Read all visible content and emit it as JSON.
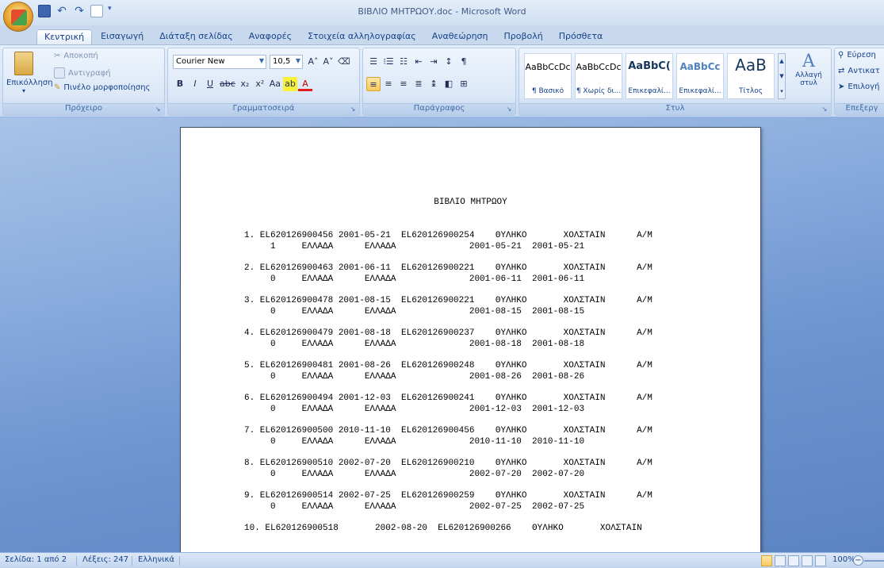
{
  "window": {
    "title": "ΒΙΒΛΙΟ ΜΗΤΡΩΟΥ.doc - Microsoft Word"
  },
  "tabs": [
    "Κεντρική",
    "Εισαγωγή",
    "Διάταξη σελίδας",
    "Αναφορές",
    "Στοιχεία αλληλογραφίας",
    "Αναθεώρηση",
    "Προβολή",
    "Πρόσθετα"
  ],
  "clipboard": {
    "paste": "Επικόλληση",
    "cut": "Αποκοπή",
    "copy": "Αντιγραφή",
    "format_painter": "Πινέλο μορφοποίησης",
    "label": "Πρόχειρο"
  },
  "font": {
    "name": "Courier New",
    "size": "10,5",
    "label": "Γραμματοσειρά"
  },
  "paragraph": {
    "label": "Παράγραφος"
  },
  "styles": {
    "items": [
      {
        "sample": "AaBbCcDc",
        "name": "¶ Βασικό"
      },
      {
        "sample": "AaBbCcDc",
        "name": "¶ Χωρίς δι..."
      },
      {
        "sample": "AaBbC(",
        "name": "Επικεφαλί..."
      },
      {
        "sample": "AaBbCc",
        "name": "Επικεφαλί..."
      },
      {
        "sample": "AaB",
        "name": "Τίτλος"
      }
    ],
    "change": "Αλλαγή στυλ",
    "label": "Στυλ"
  },
  "editing": {
    "find": "Εύρεση",
    "replace": "Αντικατ",
    "select": "Επιλογή",
    "label": "Επεξεργ"
  },
  "document": {
    "title": "ΒΙΒΛΙΟ ΜΗΤΡΩΟΥ",
    "records": [
      {
        "l1": "1. EL620126900456 2001-05-21  EL620126900254    ΘΥΛΗΚΟ       ΧΟΛΣΤΑΙΝ      Α/Μ",
        "l2": "     1     ΕΛΛΑΔΑ      ΕΛΛΑΔΑ              2001-05-21  2001-05-21"
      },
      {
        "l1": "2. EL620126900463 2001-06-11  EL620126900221    ΘΥΛΗΚΟ       ΧΟΛΣΤΑΙΝ      Α/Μ",
        "l2": "     0     ΕΛΛΑΔΑ      ΕΛΛΑΔΑ              2001-06-11  2001-06-11"
      },
      {
        "l1": "3. EL620126900478 2001-08-15  EL620126900221    ΘΥΛΗΚΟ       ΧΟΛΣΤΑΙΝ      Α/Μ",
        "l2": "     0     ΕΛΛΑΔΑ      ΕΛΛΑΔΑ              2001-08-15  2001-08-15"
      },
      {
        "l1": "4. EL620126900479 2001-08-18  EL620126900237    ΘΥΛΗΚΟ       ΧΟΛΣΤΑΙΝ      Α/Μ",
        "l2": "     0     ΕΛΛΑΔΑ      ΕΛΛΑΔΑ              2001-08-18  2001-08-18"
      },
      {
        "l1": "5. EL620126900481 2001-08-26  EL620126900248    ΘΥΛΗΚΟ       ΧΟΛΣΤΑΙΝ      Α/Μ",
        "l2": "     0     ΕΛΛΑΔΑ      ΕΛΛΑΔΑ              2001-08-26  2001-08-26"
      },
      {
        "l1": "6. EL620126900494 2001-12-03  EL620126900241    ΘΥΛΗΚΟ       ΧΟΛΣΤΑΙΝ      Α/Μ",
        "l2": "     0     ΕΛΛΑΔΑ      ΕΛΛΑΔΑ              2001-12-03  2001-12-03"
      },
      {
        "l1": "7. EL620126900500 2010-11-10  EL620126900456    ΘΥΛΗΚΟ       ΧΟΛΣΤΑΙΝ      Α/Μ",
        "l2": "     0     ΕΛΛΑΔΑ      ΕΛΛΑΔΑ              2010-11-10  2010-11-10"
      },
      {
        "l1": "8. EL620126900510 2002-07-20  EL620126900210    ΘΥΛΗΚΟ       ΧΟΛΣΤΑΙΝ      Α/Μ",
        "l2": "     0     ΕΛΛΑΔΑ      ΕΛΛΑΔΑ              2002-07-20  2002-07-20"
      },
      {
        "l1": "9. EL620126900514 2002-07-25  EL620126900259    ΘΥΛΗΚΟ       ΧΟΛΣΤΑΙΝ      Α/Μ",
        "l2": "     0     ΕΛΛΑΔΑ      ΕΛΛΑΔΑ              2002-07-25  2002-07-25"
      },
      {
        "l1": "10. EL620126900518       2002-08-20  EL620126900266    ΘΥΛΗΚΟ       ΧΟΛΣΤΑΙΝ",
        "l2": ""
      }
    ]
  },
  "status": {
    "page": "Σελίδα: 1 από 2",
    "words": "Λέξεις: 247",
    "language": "Ελληνικά",
    "zoom": "100%"
  },
  "colors": {
    "ribbon_bg": "#dbe7f7",
    "workspace_bg": "#6d95cf",
    "text": "#15428b"
  }
}
